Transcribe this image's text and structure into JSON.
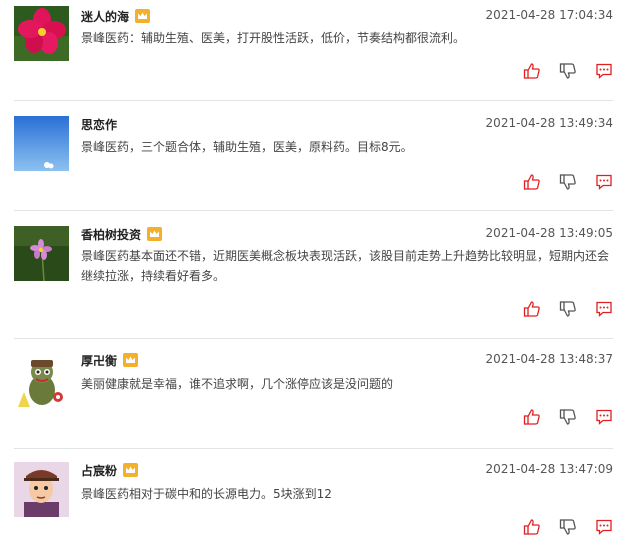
{
  "colors": {
    "accent_red": "#e02020",
    "vip_gold": "#f2b02b",
    "timestamp": "#555555",
    "divider": "#e3e3e3"
  },
  "icons": {
    "like": "thumbs-up-icon",
    "dislike": "thumbs-down-icon",
    "comment": "comment-icon",
    "vip": "crown-vip-icon"
  },
  "posts": [
    {
      "username": "迷人的海",
      "timestamp": "2021-04-28 17:04:34",
      "content": "景峰医药：辅助生殖、医美，打开股性活跃，低价，节奏结构都很流利。",
      "vip": true,
      "avatar": "pink-flower"
    },
    {
      "username": "思恋作",
      "timestamp": "2021-04-28 13:49:34",
      "content": "景峰医药，三个题合体，辅助生殖，医美，原料药。目标8元。",
      "vip": false,
      "avatar": "blue-sky"
    },
    {
      "username": "香柏树投资",
      "timestamp": "2021-04-28 13:49:05",
      "content": "景峰医药基本面还不错，近期医美概念板块表现活跃，该股目前走势上升趋势比较明显，短期内还会继续拉涨，持续看好看多。",
      "vip": true,
      "avatar": "purple-flower"
    },
    {
      "username": "厚卍衡",
      "timestamp": "2021-04-28 13:48:37",
      "content": "美丽健康就是幸福，谁不追求啊，几个涨停应该是没问题的",
      "vip": true,
      "avatar": "cartoon-figure"
    },
    {
      "username": "占宸粉",
      "timestamp": "2021-04-28 13:47:09",
      "content": "景峰医药相对于碳中和的长源电力。5块涨到12",
      "vip": true,
      "avatar": "cartoon-portrait"
    }
  ]
}
